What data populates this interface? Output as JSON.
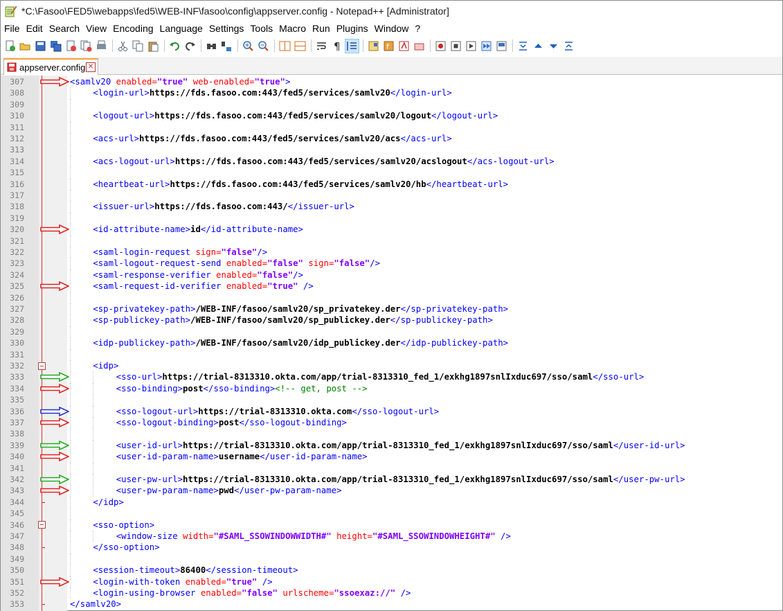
{
  "window": {
    "title": "*C:\\Fasoo\\FED5\\webapps\\fed5\\WEB-INF\\fasoo\\config\\appserver.config - Notepad++ [Administrator]"
  },
  "menu": [
    "File",
    "Edit",
    "Search",
    "View",
    "Encoding",
    "Language",
    "Settings",
    "Tools",
    "Macro",
    "Run",
    "Plugins",
    "Window",
    "?"
  ],
  "toolbar": {
    "buttons": [
      "new-file-icon",
      "open-file-icon",
      "save-icon",
      "save-all-icon",
      "close-icon",
      "close-all-icon",
      "print-icon",
      "cut-icon",
      "copy-icon",
      "paste-icon",
      "undo-icon",
      "redo-icon",
      "find-icon",
      "replace-icon",
      "zoom-in-icon",
      "zoom-out-icon",
      "sync-vertical-icon",
      "sync-horizontal-icon",
      "word-wrap-icon",
      "show-all-characters-icon",
      "indent-guide-icon",
      "document-map-icon",
      "function-list-icon",
      "folder-workspace-icon",
      "monitoring-icon",
      "record-macro-icon",
      "stop-record-icon",
      "playback-icon",
      "run-macro-multiple-icon",
      "save-macro-icon",
      "fold-all-icon",
      "up-icon",
      "down-icon",
      "unfold-all-icon"
    ]
  },
  "tab": {
    "label": "appserver.config",
    "close": "✕"
  },
  "colors": {
    "tag": "#0000ff",
    "attribute": "#ff0000",
    "value": "#8000ff",
    "text": "#000000",
    "comment": "#008000",
    "arrow_red": "#e02020",
    "arrow_green": "#22aa22",
    "arrow_blue": "#2233cc"
  },
  "lines": [
    {
      "n": "307",
      "indent": 0,
      "arrow": "red",
      "tokens": [
        [
          "t",
          "<samlv20 "
        ],
        [
          "a",
          "enabled="
        ],
        [
          "v",
          "\"true\""
        ],
        [
          "a",
          " web-enabled="
        ],
        [
          "v",
          "\"true\""
        ],
        [
          "t",
          ">"
        ]
      ]
    },
    {
      "n": "308",
      "indent": 1,
      "tokens": [
        [
          "t",
          "<login-url>"
        ],
        [
          "x",
          "https://fds.fasoo.com:443/fed5/services/samlv20"
        ],
        [
          "t",
          "</login-url>"
        ]
      ]
    },
    {
      "n": "309",
      "indent": 1,
      "tokens": []
    },
    {
      "n": "310",
      "indent": 1,
      "tokens": [
        [
          "t",
          "<logout-url>"
        ],
        [
          "x",
          "https://fds.fasoo.com:443/fed5/services/samlv20/logout"
        ],
        [
          "t",
          "</logout-url>"
        ]
      ]
    },
    {
      "n": "311",
      "indent": 1,
      "tokens": []
    },
    {
      "n": "312",
      "indent": 1,
      "tokens": [
        [
          "t",
          "<acs-url>"
        ],
        [
          "x",
          "https://fds.fasoo.com:443/fed5/services/samlv20/acs"
        ],
        [
          "t",
          "</acs-url>"
        ]
      ]
    },
    {
      "n": "313",
      "indent": 1,
      "tokens": []
    },
    {
      "n": "314",
      "indent": 1,
      "tokens": [
        [
          "t",
          "<acs-logout-url>"
        ],
        [
          "x",
          "https://fds.fasoo.com:443/fed5/services/samlv20/acslogout"
        ],
        [
          "t",
          "</acs-logout-url>"
        ]
      ]
    },
    {
      "n": "315",
      "indent": 1,
      "tokens": []
    },
    {
      "n": "316",
      "indent": 1,
      "tokens": [
        [
          "t",
          "<heartbeat-url>"
        ],
        [
          "x",
          "https://fds.fasoo.com:443/fed5/services/samlv20/hb"
        ],
        [
          "t",
          "</heartbeat-url>"
        ]
      ]
    },
    {
      "n": "317",
      "indent": 1,
      "tokens": []
    },
    {
      "n": "318",
      "indent": 1,
      "tokens": [
        [
          "t",
          "<issuer-url>"
        ],
        [
          "x",
          "https://fds.fasoo.com:443/"
        ],
        [
          "t",
          "</issuer-url>"
        ]
      ]
    },
    {
      "n": "319",
      "indent": 1,
      "tokens": []
    },
    {
      "n": "320",
      "indent": 1,
      "arrow": "red",
      "tokens": [
        [
          "t",
          "<id-attribute-name>"
        ],
        [
          "x",
          "id"
        ],
        [
          "t",
          "</id-attribute-name>"
        ]
      ]
    },
    {
      "n": "321",
      "indent": 1,
      "tokens": []
    },
    {
      "n": "322",
      "indent": 1,
      "tokens": [
        [
          "t",
          "<saml-login-request "
        ],
        [
          "a",
          "sign="
        ],
        [
          "v",
          "\"false\""
        ],
        [
          "t",
          "/>"
        ]
      ]
    },
    {
      "n": "323",
      "indent": 1,
      "tokens": [
        [
          "t",
          "<saml-logout-request-send "
        ],
        [
          "a",
          "enabled="
        ],
        [
          "v",
          "\"false\""
        ],
        [
          "a",
          " sign="
        ],
        [
          "v",
          "\"false\""
        ],
        [
          "t",
          "/>"
        ]
      ]
    },
    {
      "n": "324",
      "indent": 1,
      "tokens": [
        [
          "t",
          "<saml-response-verifier "
        ],
        [
          "a",
          "enabled="
        ],
        [
          "v",
          "\"false\""
        ],
        [
          "t",
          "/>"
        ]
      ]
    },
    {
      "n": "325",
      "indent": 1,
      "arrow": "red",
      "tokens": [
        [
          "t",
          "<saml-request-id-verifier "
        ],
        [
          "a",
          "enabled="
        ],
        [
          "v",
          "\"true\""
        ],
        [
          "t",
          " />"
        ]
      ]
    },
    {
      "n": "326",
      "indent": 1,
      "tokens": []
    },
    {
      "n": "327",
      "indent": 1,
      "tokens": [
        [
          "t",
          "<sp-privatekey-path>"
        ],
        [
          "x",
          "/WEB-INF/fasoo/samlv20/sp_privatekey.der"
        ],
        [
          "t",
          "</sp-privatekey-path>"
        ]
      ]
    },
    {
      "n": "328",
      "indent": 1,
      "tokens": [
        [
          "t",
          "<sp-publickey-path>"
        ],
        [
          "x",
          "/WEB-INF/fasoo/samlv20/sp_publickey.der"
        ],
        [
          "t",
          "</sp-publickey-path>"
        ]
      ]
    },
    {
      "n": "329",
      "indent": 1,
      "tokens": []
    },
    {
      "n": "330",
      "indent": 1,
      "tokens": [
        [
          "t",
          "<idp-publickey-path>"
        ],
        [
          "x",
          "/WEB-INF/fasoo/samlv20/idp_publickey.der"
        ],
        [
          "t",
          "</idp-publickey-path>"
        ]
      ]
    },
    {
      "n": "331",
      "indent": 1,
      "tokens": []
    },
    {
      "n": "332",
      "indent": 1,
      "fold": "open",
      "tokens": [
        [
          "t",
          "<idp>"
        ]
      ]
    },
    {
      "n": "333",
      "indent": 2,
      "arrow": "green",
      "tokens": [
        [
          "t",
          "<sso-url>"
        ],
        [
          "x",
          "https://trial-8313310.okta.com/app/trial-8313310_fed_1/exkhg1897snlIxduc697/sso/saml"
        ],
        [
          "t",
          "</sso-url>"
        ]
      ]
    },
    {
      "n": "334",
      "indent": 2,
      "arrow": "red",
      "tokens": [
        [
          "t",
          "<sso-binding>"
        ],
        [
          "x",
          "post"
        ],
        [
          "t",
          "</sso-binding>"
        ],
        [
          "c",
          "<!-- get, post -->"
        ]
      ]
    },
    {
      "n": "335",
      "indent": 2,
      "tokens": []
    },
    {
      "n": "336",
      "indent": 2,
      "arrow": "blue",
      "tokens": [
        [
          "t",
          "<sso-logout-url>"
        ],
        [
          "x",
          "https://trial-8313310.okta.com"
        ],
        [
          "t",
          "</sso-logout-url>"
        ]
      ]
    },
    {
      "n": "337",
      "indent": 2,
      "arrow": "red",
      "tokens": [
        [
          "t",
          "<sso-logout-binding>"
        ],
        [
          "x",
          "post"
        ],
        [
          "t",
          "</sso-logout-binding>"
        ]
      ]
    },
    {
      "n": "338",
      "indent": 2,
      "tokens": []
    },
    {
      "n": "339",
      "indent": 2,
      "arrow": "green",
      "tokens": [
        [
          "t",
          "<user-id-url>"
        ],
        [
          "x",
          "https://trial-8313310.okta.com/app/trial-8313310_fed_1/exkhg1897snlIxduc697/sso/saml"
        ],
        [
          "t",
          "</user-id-url>"
        ]
      ]
    },
    {
      "n": "340",
      "indent": 2,
      "arrow": "red",
      "tokens": [
        [
          "t",
          "<user-id-param-name>"
        ],
        [
          "x",
          "username"
        ],
        [
          "t",
          "</user-id-param-name>"
        ]
      ]
    },
    {
      "n": "341",
      "indent": 2,
      "tokens": []
    },
    {
      "n": "342",
      "indent": 2,
      "arrow": "green",
      "tokens": [
        [
          "t",
          "<user-pw-url>"
        ],
        [
          "x",
          "https://trial-8313310.okta.com/app/trial-8313310_fed_1/exkhg1897snlIxduc697/sso/saml"
        ],
        [
          "t",
          "</user-pw-url>"
        ]
      ]
    },
    {
      "n": "343",
      "indent": 2,
      "arrow": "red",
      "tokens": [
        [
          "t",
          "<user-pw-param-name>"
        ],
        [
          "x",
          "pwd"
        ],
        [
          "t",
          "</user-pw-param-name>"
        ]
      ]
    },
    {
      "n": "344",
      "indent": 1,
      "foldend": true,
      "tokens": [
        [
          "t",
          "</idp>"
        ]
      ]
    },
    {
      "n": "345",
      "indent": 1,
      "tokens": []
    },
    {
      "n": "346",
      "indent": 1,
      "fold": "open",
      "tokens": [
        [
          "t",
          "<sso-option>"
        ]
      ]
    },
    {
      "n": "347",
      "indent": 2,
      "tokens": [
        [
          "t",
          "<window-size "
        ],
        [
          "a",
          "width="
        ],
        [
          "v",
          "\"#SAML_SSOWINDOWWIDTH#\""
        ],
        [
          "a",
          " height="
        ],
        [
          "v",
          "\"#SAML_SSOWINDOWHEIGHT#\""
        ],
        [
          "t",
          " />"
        ]
      ]
    },
    {
      "n": "348",
      "indent": 1,
      "foldend": true,
      "tokens": [
        [
          "t",
          "</sso-option>"
        ]
      ]
    },
    {
      "n": "349",
      "indent": 1,
      "tokens": []
    },
    {
      "n": "350",
      "indent": 1,
      "tokens": [
        [
          "t",
          "<session-timeout>"
        ],
        [
          "x",
          "86400"
        ],
        [
          "t",
          "</session-timeout>"
        ]
      ]
    },
    {
      "n": "351",
      "indent": 1,
      "arrow": "red",
      "tokens": [
        [
          "t",
          "<login-with-token "
        ],
        [
          "a",
          "enabled="
        ],
        [
          "v",
          "\"true\""
        ],
        [
          "t",
          " />"
        ]
      ]
    },
    {
      "n": "352",
      "indent": 1,
      "tokens": [
        [
          "t",
          "<login-using-browser "
        ],
        [
          "a",
          "enabled="
        ],
        [
          "v",
          "\"false\""
        ],
        [
          "a",
          " urlscheme="
        ],
        [
          "v",
          "\"ssoexaz://\""
        ],
        [
          "t",
          " />"
        ]
      ]
    },
    {
      "n": "353",
      "indent": 0,
      "foldend": true,
      "tokens": [
        [
          "t",
          "</samlv20>"
        ]
      ]
    }
  ]
}
